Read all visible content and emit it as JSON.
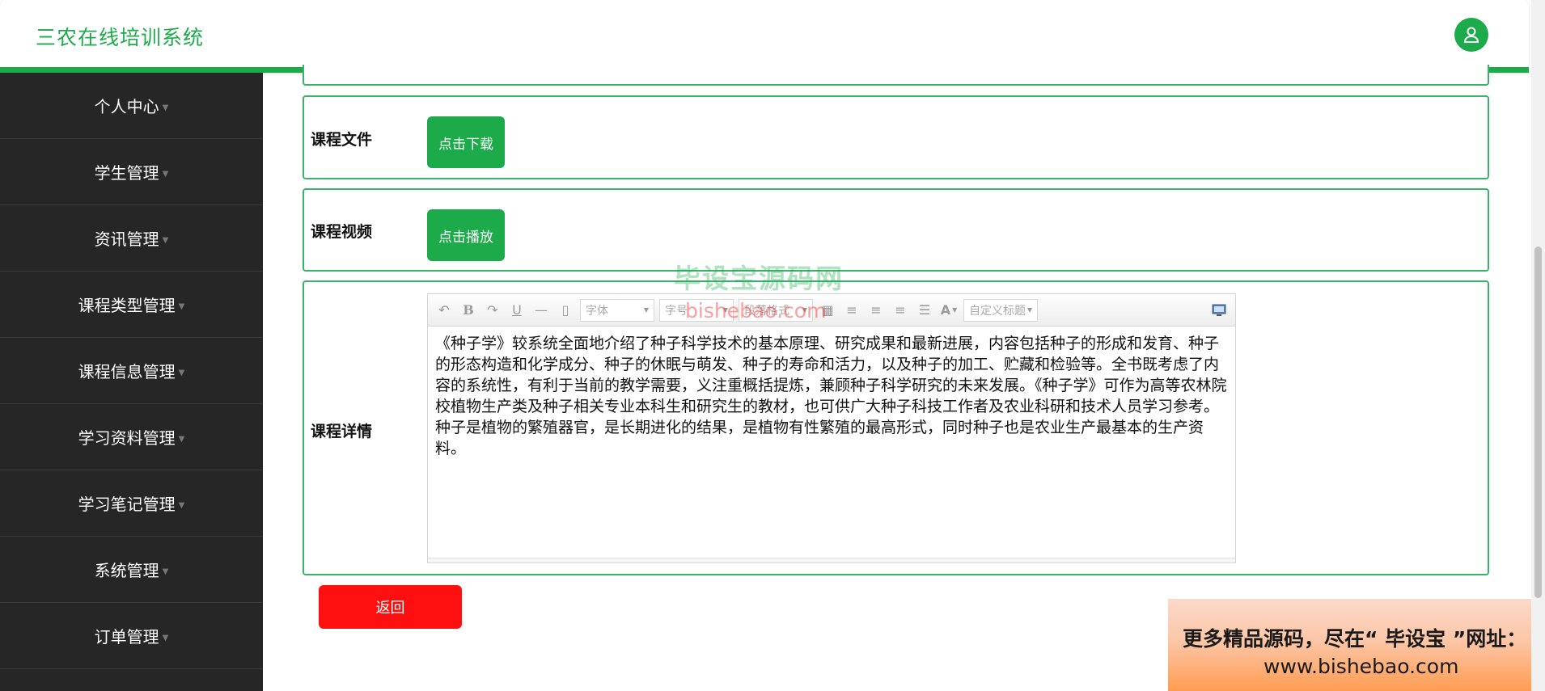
{
  "header": {
    "title": "三农在线培训系统",
    "avatar_icon": "user-icon",
    "accent_color": "#1daa4b"
  },
  "sidebar": {
    "items": [
      {
        "label": "个人中心"
      },
      {
        "label": "学生管理"
      },
      {
        "label": "资讯管理"
      },
      {
        "label": "课程类型管理"
      },
      {
        "label": "课程信息管理"
      },
      {
        "label": "学习资料管理"
      },
      {
        "label": "学习笔记管理"
      },
      {
        "label": "系统管理"
      },
      {
        "label": "订单管理"
      }
    ]
  },
  "form": {
    "course_file": {
      "label": "课程文件",
      "button": "点击下载"
    },
    "course_video": {
      "label": "课程视频",
      "button": "点击播放"
    },
    "course_detail": {
      "label": "课程详情",
      "toolbar": {
        "font_family_placeholder": "字体",
        "font_size_placeholder": "字号",
        "paragraph_format_placeholder": "段落格式",
        "custom_heading_placeholder": "自定义标题"
      },
      "content": "《种子学》较系统全面地介绍了种子科学技术的基本原理、研究成果和最新进展，内容包括种子的形成和发育、种子的形态构造和化学成分、种子的休眠与萌发、种子的寿命和活力，以及种子的加工、贮藏和检验等。全书既考虑了内容的系统性，有利于当前的教学需要，义注重概括提炼，兼顾种子科学研究的未来发展。《种子学》可作为高等农林院校植物生产类及种子相关专业本科生和研究生的教材，也可供广大种子科技工作者及农业科研和技术人员学习参考。 种子是植物的繁殖器官，是长期进化的结果，是植物有性繁殖的最高形式，同时种子也是农业生产最基本的生产资料。"
    },
    "return_button": "返回",
    "return_color": "#ff1010"
  },
  "watermark": {
    "text_cn": "毕设宝源码网",
    "text_url": "bishebao.com"
  },
  "ad_banner": {
    "line1": "更多精品源码，尽在“ 毕设宝 ”网址：",
    "line2": "www.bishebao.com"
  }
}
